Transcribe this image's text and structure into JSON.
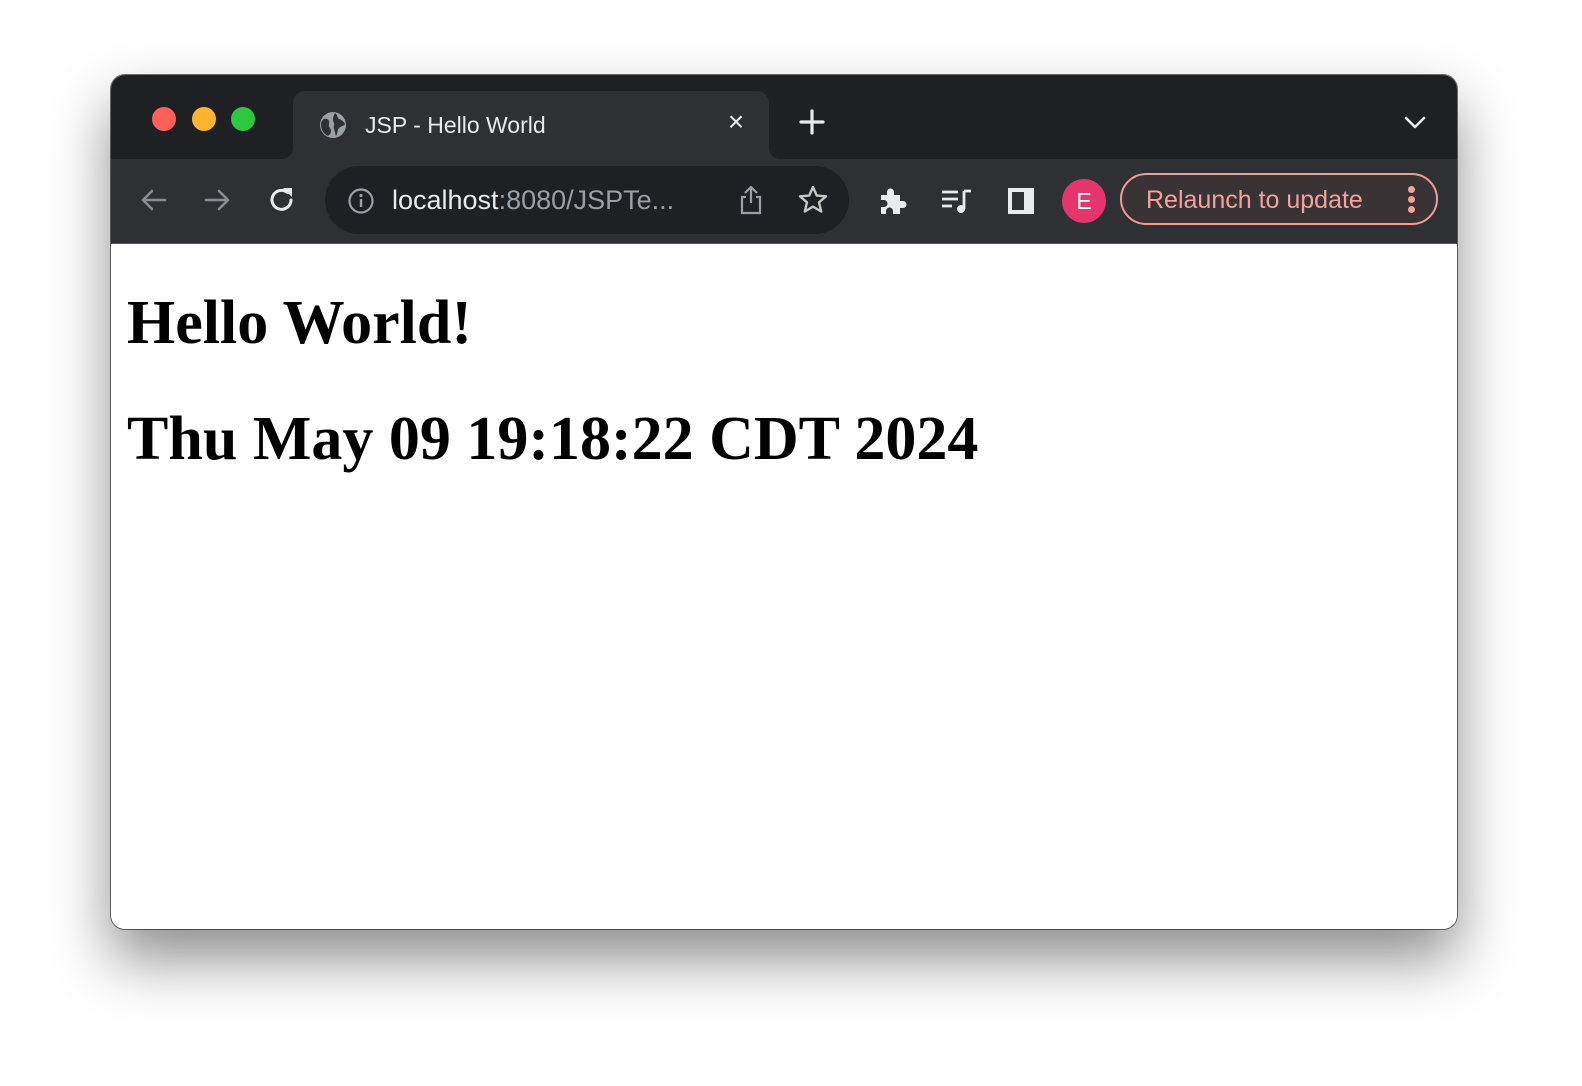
{
  "window": {
    "traffic_lights": [
      "close",
      "minimize",
      "zoom"
    ]
  },
  "tab": {
    "title": "JSP - Hello World",
    "favicon": "globe-icon",
    "close_glyph": "×"
  },
  "toolbar": {
    "back_icon": "arrow-left-icon",
    "forward_icon": "arrow-right-icon",
    "reload_icon": "reload-icon",
    "url_host": "localhost",
    "url_rest": ":8080/JSPTe...",
    "profile_initial": "E",
    "relaunch_label": "Relaunch to update"
  },
  "colors": {
    "titlebar": "#1f2023",
    "toolbar": "#2f3034",
    "avatar": "#e5356d",
    "relaunch_accent": "#f4a29a"
  },
  "page": {
    "heading": "Hello World!",
    "date": "Thu May 09 19:18:22 CDT 2024"
  }
}
